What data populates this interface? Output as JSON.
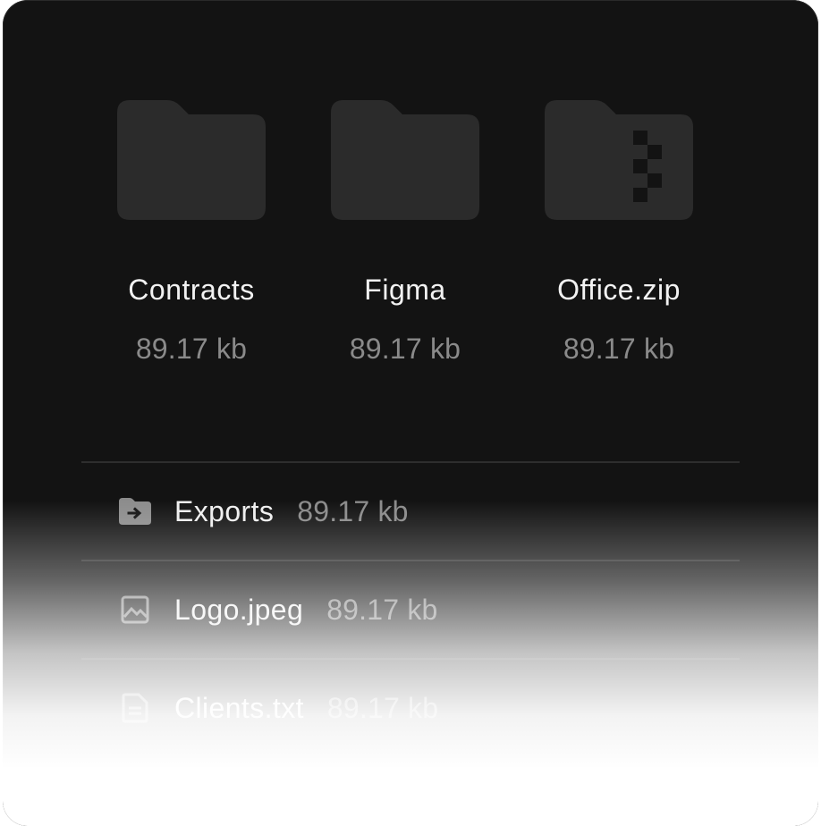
{
  "folders": [
    {
      "name": "Contracts",
      "size": "89.17 kb",
      "icon": "folder-icon"
    },
    {
      "name": "Figma",
      "size": "89.17 kb",
      "icon": "folder-icon"
    },
    {
      "name": "Office.zip",
      "size": "89.17 kb",
      "icon": "zip-folder-icon"
    }
  ],
  "files": [
    {
      "name": "Exports",
      "size": "89.17 kb",
      "icon": "folder-export-icon"
    },
    {
      "name": "Logo.jpeg",
      "size": "89.17 kb",
      "icon": "image-icon"
    },
    {
      "name": "Clients.txt",
      "size": "89.17 kb",
      "icon": "text-file-icon"
    }
  ],
  "colors": {
    "background": "#131313",
    "folder_fill": "#2b2b2b",
    "text_primary": "#f2f2f2",
    "text_secondary": "#8a8a8a",
    "divider": "#2e2e2e"
  }
}
